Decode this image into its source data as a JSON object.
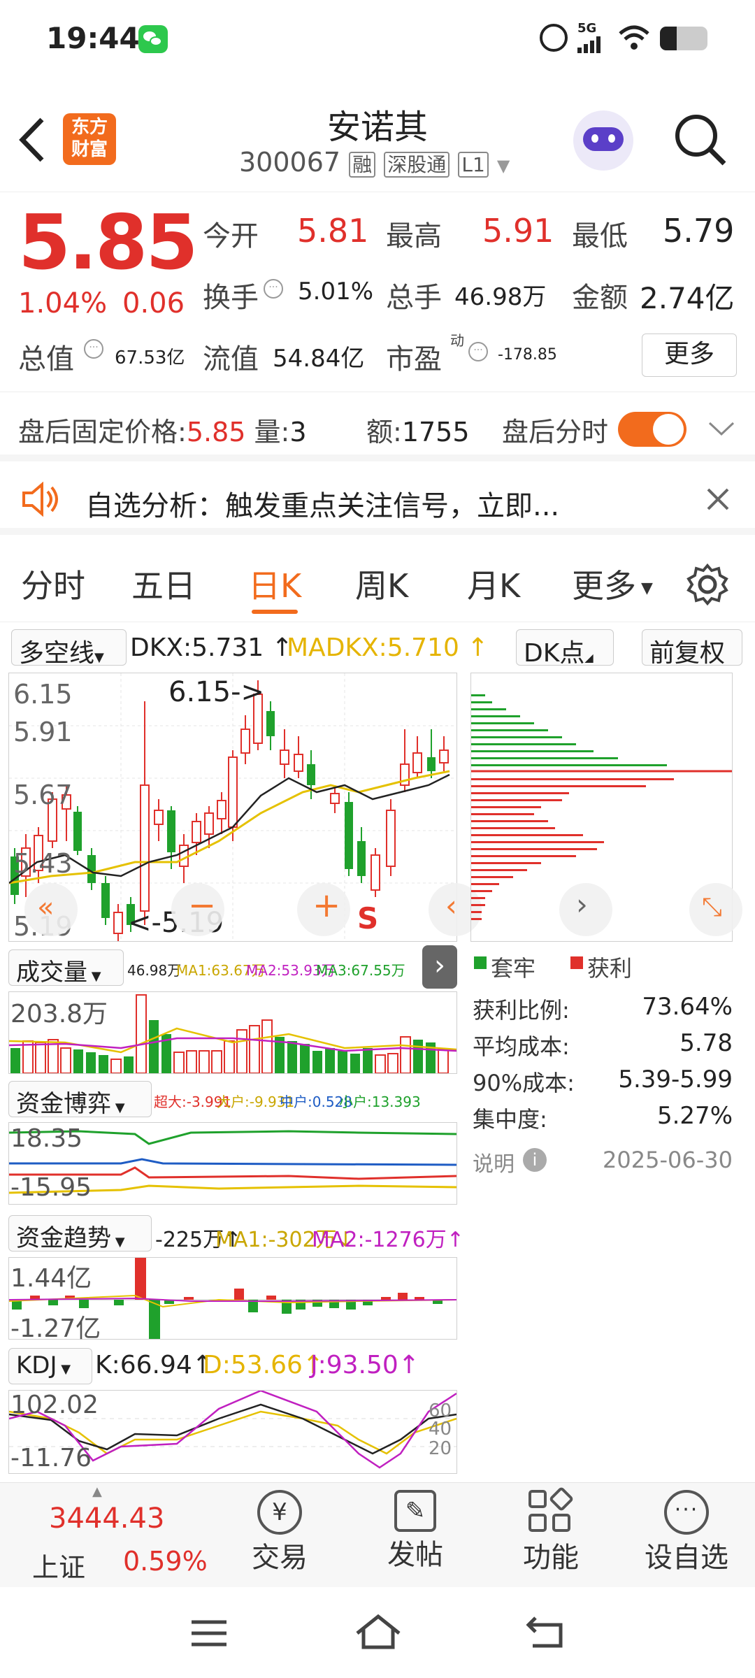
{
  "status_bar": {
    "time": "19:44",
    "network": "5G"
  },
  "header": {
    "back_icon": "chevron-left-icon",
    "logo_line1": "东方",
    "logo_line2": "财富",
    "stock_name": "安诺其",
    "stock_code": "300067",
    "tag_rong": "融",
    "tag_sgt": "深股通",
    "tag_level": "L1"
  },
  "quote": {
    "price": "5.85",
    "change_pct": "1.04%",
    "change_amt": "0.06",
    "open_label": "今开",
    "open": "5.81",
    "high_label": "最高",
    "high": "5.91",
    "low_label": "最低",
    "low": "5.79",
    "turnover_label": "换手",
    "turnover": "5.01%",
    "volume_label": "总手",
    "volume": "46.98万",
    "amount_label": "金额",
    "amount": "2.74亿",
    "mktcap_label": "总值",
    "mktcap": "67.53亿",
    "float_label": "流值",
    "float": "54.84亿",
    "pe_label": "市盈",
    "pe_sup": "动",
    "pe": "-178.85",
    "more_label": "更多"
  },
  "after_hours": {
    "price_label": "盘后固定价格:",
    "price": "5.85",
    "volume_label": "量:",
    "volume": "3",
    "amount_label": "额:",
    "amount": "1755",
    "toggle_label": "盘后分时"
  },
  "notice": {
    "text": "自选分析：触发重点关注信号，立即..."
  },
  "tabs": [
    {
      "label": "分时"
    },
    {
      "label": "五日"
    },
    {
      "label": "日K"
    },
    {
      "label": "周K"
    },
    {
      "label": "月K"
    },
    {
      "label": "更多"
    }
  ],
  "kline": {
    "indicator_select": "多空线",
    "dkx": "DKX:5.731",
    "madkx": "MADKX:5.710",
    "dk_btn": "DK点",
    "adj_btn": "前复权",
    "y_labels": [
      "6.15",
      "5.91",
      "5.67",
      "5.43",
      "5.19"
    ],
    "max_label": "6.15->",
    "min_label": "<-5.19",
    "s_mark": "S"
  },
  "chip": {
    "legend_trap": "套牢",
    "legend_profit": "获利",
    "rows": [
      {
        "label": "获利比例:",
        "value": "73.64%"
      },
      {
        "label": "平均成本:",
        "value": "5.78"
      },
      {
        "label": "90%成本:",
        "value": "5.39-5.99"
      },
      {
        "label": "集中度:",
        "value": "5.27%"
      }
    ],
    "note_label": "说明",
    "date": "2025-06-30"
  },
  "volume": {
    "select": "成交量",
    "vol": "46.98万",
    "ma1": "MA1:63.67万",
    "ma2": "MA2:53.93万",
    "ma3": "MA3:67.55万",
    "y_top": "203.8万"
  },
  "fund_game": {
    "select": "资金博弈",
    "big": "超大:-3.991",
    "large": "大户:-9.931",
    "mid": "中户:0.528",
    "small": "小户:13.393",
    "y_top": "18.35",
    "y_bottom": "-15.95"
  },
  "fund_trend": {
    "select": "资金趋势",
    "value": "-225万",
    "ma1": "MA1:-302万",
    "ma2": "MA2:-1276万",
    "y_top": "1.44亿",
    "y_bottom": "-1.27亿"
  },
  "kdj": {
    "select": "KDJ",
    "k": "K:66.94",
    "d": "D:53.66",
    "j": "J:93.50",
    "y_top": "102.02",
    "y_bottom": "-11.76",
    "r_top": "60",
    "r_mid": "40",
    "r_bottom": "20"
  },
  "bottom_nav": {
    "index_value": "3444.43",
    "index_name": "上证",
    "index_change": "0.59%",
    "items": [
      {
        "label": "交易"
      },
      {
        "label": "发帖"
      },
      {
        "label": "功能"
      },
      {
        "label": "设自选"
      }
    ]
  },
  "colors": {
    "up": "#e0302b",
    "down": "#1fa12c",
    "accent": "#f26b1d",
    "ma_yellow": "#e5c100",
    "ma_magenta": "#c020c0"
  }
}
